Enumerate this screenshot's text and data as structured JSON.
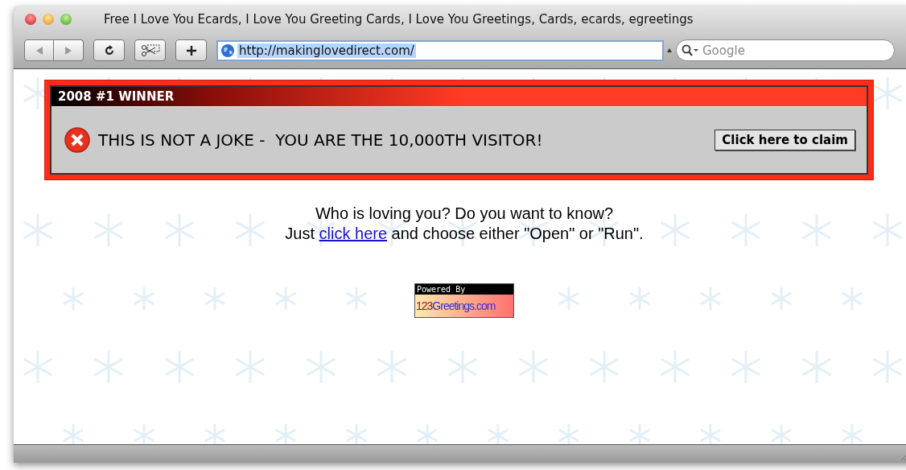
{
  "window": {
    "title": "Free I Love You Ecards, I Love You Greeting Cards, I Love You Greetings, Cards, ecards, egreetings"
  },
  "toolbar": {
    "url": "http://makinglovedirect.com/",
    "url_selected": true,
    "search": {
      "placeholder": "Google"
    }
  },
  "ad": {
    "header": "2008 #1 WINNER",
    "message": "THIS IS NOT A JOKE -  YOU ARE THE 10,000TH VISITOR!",
    "button": "Click here to claim"
  },
  "content": {
    "line_1": "Who is loving you? Do you want to know?",
    "line_2": {
      "before": "Just ",
      "link": "click here",
      "after": " and choose either \"Open\" or \"Run\"."
    }
  },
  "badge": {
    "caption": "Powered By",
    "logo_number": "123",
    "logo_name": "Greetings.com"
  }
}
